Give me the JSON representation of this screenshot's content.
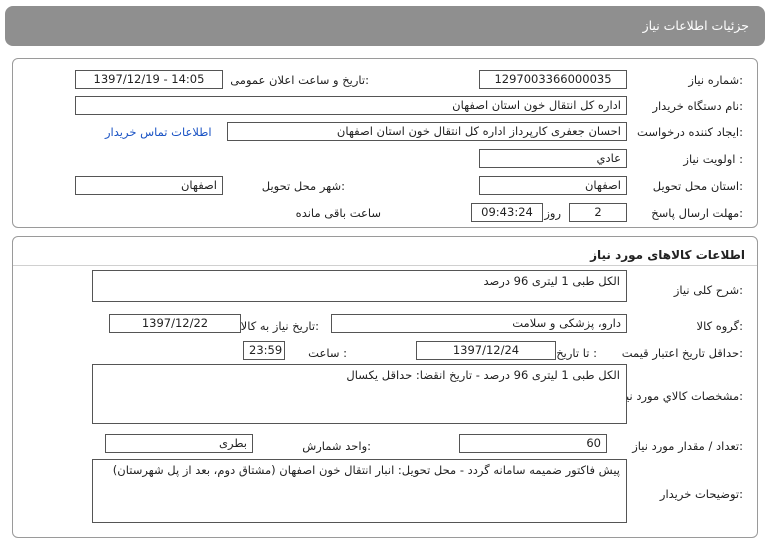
{
  "header": {
    "title": "جزئیات اطلاعات نیاز"
  },
  "info": {
    "need_number_label": "شماره نیاز:",
    "need_number": "1297003366000035",
    "announce_label": "تاریخ و ساعت اعلان عمومی:",
    "announce_value": "1397/12/19 - 14:05",
    "buyer_org_label": "نام دستگاه خریدار:",
    "buyer_org": "اداره کل انتقال خون استان اصفهان",
    "requester_label": "ایجاد کننده درخواست:",
    "requester": "احسان جعفری کارپرداز اداره کل انتقال خون استان اصفهان",
    "contact_link": "اطلاعات تماس خریدار",
    "priority_label": "اولویت نیاز :",
    "priority": "عادي",
    "province_label": "استان محل تحویل:",
    "province": "اصفهان",
    "city_label": "شهر محل تحویل:",
    "city": "اصفهان",
    "deadline_label": "مهلت ارسال پاسخ:",
    "deadline_days": "2",
    "days_label": "روز و",
    "deadline_time": "09:43:24",
    "remaining_label": "ساعت باقی مانده"
  },
  "goods": {
    "section_title": "اطلاعات کالاهای مورد نیاز",
    "summary_label": "شرح کلی نیاز:",
    "summary": "الکل طبی 1 لیتری 96 درصد",
    "group_label": "گروه کالا:",
    "group": "دارو، پزشکی و سلامت",
    "need_date_label": "تاریخ نیاز به کالا:",
    "need_date": "1397/12/22",
    "validity_label": "حداقل تاریخ اعتبار قیمت:",
    "to_date_label": "تا تاریخ :",
    "to_date": "1397/12/24",
    "time_label": "ساعت :",
    "time": "23:59",
    "spec_label": "مشخصات کالاي مورد نیاز:",
    "spec": "الکل طبی 1 لیتری 96 درصد - تاریخ انقضا: حداقل یکسال",
    "qty_label": "تعداد / مقدار مورد نیاز:",
    "qty": "60",
    "unit_label": "واحد شمارش:",
    "unit": "بطری",
    "notes_label": "توضیحات خریدار:",
    "notes": "پیش فاکتور ضمیمه سامانه گردد - محل تحویل: انبار انتقال خون اصفهان (مشتاق دوم، بعد از پل شهرستان)"
  }
}
